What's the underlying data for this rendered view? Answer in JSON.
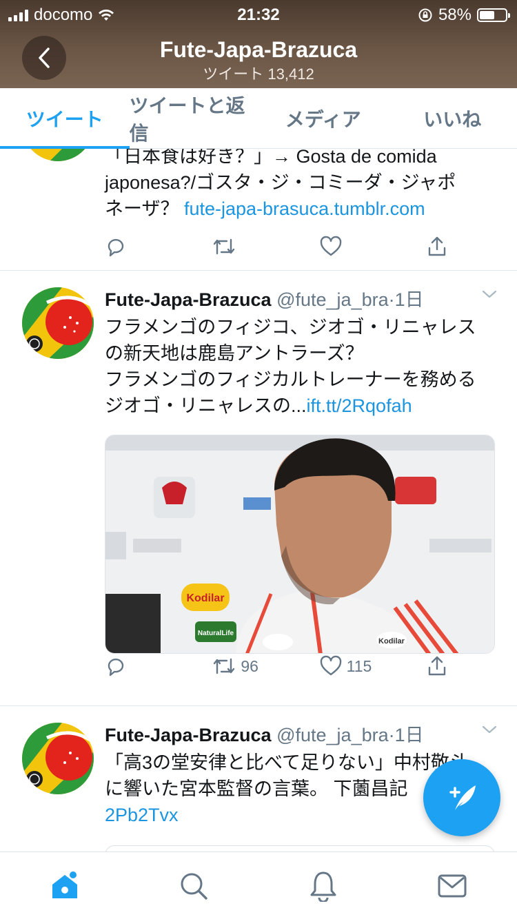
{
  "status_bar": {
    "carrier": "docomo",
    "time": "21:32",
    "battery": "58%",
    "battery_level": 0.58
  },
  "header": {
    "title": "Fute-Japa-Brazuca",
    "subtitle": "ツイート 13,412"
  },
  "tabs": [
    {
      "label": "ツイート",
      "active": true
    },
    {
      "label": "ツイートと返信",
      "active": false
    },
    {
      "label": "メディア",
      "active": false
    },
    {
      "label": "いいね",
      "active": false
    }
  ],
  "tweets": [
    {
      "lines": [
        "「日本食は好き？」→ Gosta de comida",
        "japonesa?/ゴスタ・ジ・コミーダ・ジャポ",
        "ネーザ？ "
      ],
      "link": "fute-japa-brasuca.tumblr.com",
      "retweets": "",
      "likes": ""
    },
    {
      "name": "Fute-Japa-Brazuca",
      "handle": "@fute_ja_bra",
      "time": "·1日",
      "lines": [
        "フラメンゴのフィジコ、ジオゴ・リニャレス",
        "の新天地は鹿島アントラーズ？",
        "フラメンゴのフィジカルトレーナーを務める",
        "ジオゴ・リニャレスの..."
      ],
      "link": "ift.tt/2Rqofah",
      "retweets": "96",
      "likes": "115"
    },
    {
      "name": "Fute-Japa-Brazuca",
      "handle": "@fute_ja_bra",
      "time": "·1日",
      "lines": [
        "「高3の堂安律と比べて足りない」中村敬斗",
        "に響いた宮本監督の言葉。 下薗昌記 "
      ],
      "link": "2Pb2Tvx"
    }
  ],
  "media_texts": {
    "sponsor1": "Kodilar",
    "sponsor2": "NaturalLife",
    "sponsor3": "Kodilar"
  },
  "icons": {
    "back": "chevron-left-icon",
    "reply": "reply-icon",
    "retweet": "retweet-icon",
    "like": "heart-icon",
    "share": "share-icon",
    "compose": "compose-tweet-icon",
    "home": "home-icon",
    "search": "search-icon",
    "notifications": "bell-icon",
    "messages": "mail-icon"
  },
  "colors": {
    "accent": "#1da1f2",
    "link": "#1b95e0",
    "muted": "#657786"
  }
}
